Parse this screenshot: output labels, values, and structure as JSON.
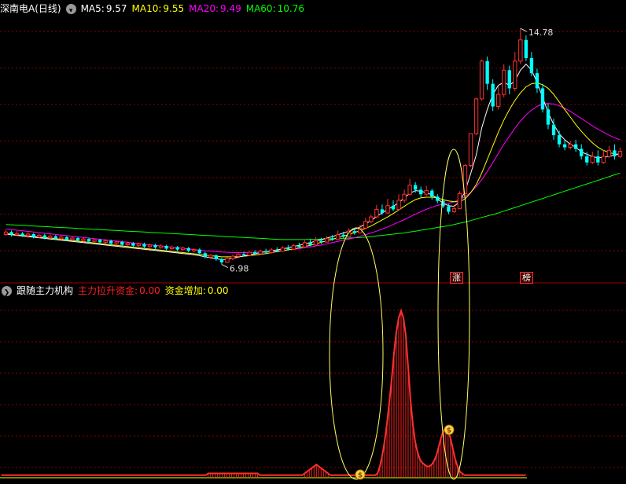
{
  "top_panel": {
    "title": "深南电A(日线)",
    "ma": [
      {
        "label": "MA5:",
        "value": "9.57",
        "color": "#ffffff"
      },
      {
        "label": "MA10:",
        "value": "9.55",
        "color": "#ffff00"
      },
      {
        "label": "MA20:",
        "value": "9.49",
        "color": "#ff00ff"
      },
      {
        "label": "MA60:",
        "value": "10.76",
        "color": "#00ff00"
      }
    ],
    "high_label": "14.78",
    "low_label": "6.98",
    "badges": [
      "涨",
      "榜"
    ]
  },
  "bottom_panel": {
    "title": "跟随主力机构",
    "items": [
      {
        "label": "主力拉升资金:",
        "value": "0.00",
        "color": "#ff2020"
      },
      {
        "label": "资金增加:",
        "value": "0.00",
        "color": "#ffff00"
      }
    ]
  },
  "chart_data": [
    {
      "type": "candlestick",
      "title": "深南电A(日线)",
      "ylim": [
        6.5,
        15.2
      ],
      "colors": {
        "up": "#ff3030",
        "down": "#00ffff",
        "ma5": "#ffffff",
        "ma10": "#ffff00",
        "ma20": "#ff00ff",
        "ma60": "#00ff00",
        "grid": "#8b0000"
      },
      "candles": [
        [
          7.97,
          8.05,
          8.12,
          7.93
        ],
        [
          8.05,
          7.96,
          8.1,
          7.9
        ],
        [
          7.96,
          8.0,
          8.08,
          7.91
        ],
        [
          8.0,
          7.93,
          8.05,
          7.88
        ],
        [
          7.93,
          7.98,
          8.04,
          7.86
        ],
        [
          7.98,
          7.89,
          8.02,
          7.84
        ],
        [
          7.89,
          7.94,
          8.0,
          7.85
        ],
        [
          7.94,
          7.86,
          7.99,
          7.81
        ],
        [
          7.86,
          7.91,
          7.97,
          7.82
        ],
        [
          7.91,
          7.83,
          7.95,
          7.78
        ],
        [
          7.83,
          7.88,
          7.94,
          7.79
        ],
        [
          7.88,
          7.8,
          7.92,
          7.75
        ],
        [
          7.8,
          7.85,
          7.9,
          7.76
        ],
        [
          7.85,
          7.77,
          7.89,
          7.72
        ],
        [
          7.77,
          7.82,
          7.88,
          7.73
        ],
        [
          7.82,
          7.74,
          7.86,
          7.69
        ],
        [
          7.74,
          7.79,
          7.84,
          7.7
        ],
        [
          7.79,
          7.71,
          7.83,
          7.66
        ],
        [
          7.71,
          7.76,
          7.82,
          7.67
        ],
        [
          7.76,
          7.67,
          7.8,
          7.62
        ],
        [
          7.67,
          7.72,
          7.77,
          7.63
        ],
        [
          7.72,
          7.63,
          7.76,
          7.58
        ],
        [
          7.63,
          7.68,
          7.74,
          7.59
        ],
        [
          7.68,
          7.6,
          7.72,
          7.55
        ],
        [
          7.6,
          7.65,
          7.7,
          7.56
        ],
        [
          7.65,
          7.57,
          7.7,
          7.52
        ],
        [
          7.57,
          7.62,
          7.67,
          7.53
        ],
        [
          7.62,
          7.54,
          7.66,
          7.49
        ],
        [
          7.54,
          7.59,
          7.64,
          7.5
        ],
        [
          7.59,
          7.5,
          7.63,
          7.45
        ],
        [
          7.5,
          7.55,
          7.6,
          7.46
        ],
        [
          7.55,
          7.47,
          7.59,
          7.42
        ],
        [
          7.47,
          7.52,
          7.57,
          7.43
        ],
        [
          7.52,
          7.43,
          7.56,
          7.38
        ],
        [
          7.43,
          7.47,
          7.52,
          7.38
        ],
        [
          7.47,
          7.35,
          7.51,
          7.3
        ],
        [
          7.35,
          7.22,
          7.4,
          7.18
        ],
        [
          7.22,
          7.28,
          7.33,
          7.16
        ],
        [
          7.28,
          7.15,
          7.31,
          7.1
        ],
        [
          7.15,
          7.05,
          7.2,
          6.98
        ],
        [
          7.05,
          7.18,
          7.22,
          7.02
        ],
        [
          7.18,
          7.25,
          7.3,
          7.12
        ],
        [
          7.25,
          7.32,
          7.38,
          7.2
        ],
        [
          7.32,
          7.28,
          7.4,
          7.24
        ],
        [
          7.28,
          7.38,
          7.42,
          7.25
        ],
        [
          7.38,
          7.33,
          7.45,
          7.29
        ],
        [
          7.33,
          7.42,
          7.47,
          7.3
        ],
        [
          7.42,
          7.37,
          7.5,
          7.32
        ],
        [
          7.37,
          7.46,
          7.52,
          7.34
        ],
        [
          7.46,
          7.42,
          7.55,
          7.38
        ],
        [
          7.42,
          7.52,
          7.58,
          7.4
        ],
        [
          7.52,
          7.48,
          7.62,
          7.44
        ],
        [
          7.48,
          7.6,
          7.65,
          7.46
        ],
        [
          7.6,
          7.56,
          7.7,
          7.52
        ],
        [
          7.56,
          7.7,
          7.78,
          7.54
        ],
        [
          7.7,
          7.62,
          7.82,
          7.58
        ],
        [
          7.62,
          7.76,
          7.88,
          7.6
        ],
        [
          7.76,
          7.72,
          7.86,
          7.66
        ],
        [
          7.72,
          7.84,
          7.92,
          7.7
        ],
        [
          7.84,
          7.8,
          7.95,
          7.76
        ],
        [
          7.8,
          7.96,
          8.1,
          7.78
        ],
        [
          7.96,
          7.9,
          8.06,
          7.84
        ],
        [
          7.9,
          8.08,
          8.18,
          7.88
        ],
        [
          8.08,
          8.02,
          8.16,
          7.96
        ],
        [
          8.02,
          8.18,
          8.28,
          8.0
        ],
        [
          8.18,
          8.4,
          8.52,
          8.15
        ],
        [
          8.4,
          8.55,
          8.62,
          8.34
        ],
        [
          8.55,
          8.8,
          8.95,
          8.5
        ],
        [
          8.8,
          8.68,
          8.96,
          8.62
        ],
        [
          8.68,
          8.92,
          9.15,
          8.65
        ],
        [
          8.92,
          8.8,
          9.1,
          8.74
        ],
        [
          8.8,
          9.1,
          9.3,
          8.76
        ],
        [
          9.1,
          9.3,
          9.45,
          9.02
        ],
        [
          9.3,
          9.6,
          9.8,
          9.25
        ],
        [
          9.6,
          9.45,
          9.7,
          9.35
        ],
        [
          9.45,
          9.3,
          9.55,
          9.2
        ],
        [
          9.3,
          9.42,
          9.58,
          9.24
        ],
        [
          9.42,
          9.22,
          9.48,
          9.12
        ],
        [
          9.22,
          9.08,
          9.3,
          9.0
        ],
        [
          9.08,
          8.9,
          9.15,
          8.84
        ],
        [
          8.9,
          8.72,
          8.98,
          8.64
        ],
        [
          8.72,
          8.82,
          8.96,
          8.68
        ],
        [
          8.82,
          9.32,
          9.4,
          8.8
        ],
        [
          9.32,
          10.25,
          10.3,
          9.3
        ],
        [
          10.25,
          11.3,
          11.3,
          10.2
        ],
        [
          11.3,
          12.45,
          12.5,
          11.25
        ],
        [
          12.45,
          13.7,
          13.75,
          12.4
        ],
        [
          13.7,
          12.95,
          13.85,
          12.75
        ],
        [
          12.95,
          12.2,
          13.1,
          12.05
        ],
        [
          12.2,
          12.6,
          12.85,
          12.1
        ],
        [
          12.6,
          13.4,
          13.6,
          12.5
        ],
        [
          13.4,
          12.8,
          13.55,
          12.6
        ],
        [
          12.8,
          13.7,
          14.0,
          12.7
        ],
        [
          13.7,
          14.4,
          14.78,
          13.6
        ],
        [
          14.4,
          13.8,
          14.55,
          13.7
        ],
        [
          13.8,
          13.3,
          14.0,
          13.2
        ],
        [
          13.3,
          12.8,
          13.45,
          12.65
        ],
        [
          12.8,
          12.1,
          12.95,
          12.0
        ],
        [
          12.1,
          11.6,
          12.3,
          11.45
        ],
        [
          11.6,
          11.25,
          11.8,
          11.1
        ],
        [
          11.25,
          10.95,
          11.4,
          10.85
        ],
        [
          10.95,
          10.85,
          11.1,
          10.75
        ],
        [
          10.85,
          10.95,
          11.05,
          10.78
        ],
        [
          10.95,
          10.8,
          11.1,
          10.7
        ],
        [
          10.8,
          10.55,
          10.95,
          10.45
        ],
        [
          10.55,
          10.35,
          10.7,
          10.25
        ],
        [
          10.35,
          10.55,
          10.7,
          10.3
        ],
        [
          10.55,
          10.35,
          10.75,
          10.25
        ],
        [
          10.35,
          10.55,
          10.75,
          10.3
        ],
        [
          10.55,
          10.75,
          10.9,
          10.5
        ],
        [
          10.75,
          10.55,
          10.95,
          10.45
        ],
        [
          10.55,
          10.72,
          10.85,
          10.5
        ]
      ],
      "ma5": [
        7.98,
        7.96,
        7.94,
        7.92,
        7.9,
        7.88,
        7.86,
        7.84,
        7.82,
        7.8,
        7.78,
        7.76,
        7.74,
        7.72,
        7.7,
        7.68,
        7.66,
        7.64,
        7.62,
        7.6,
        7.58,
        7.56,
        7.54,
        7.52,
        7.5,
        7.48,
        7.46,
        7.44,
        7.42,
        7.4,
        7.38,
        7.36,
        7.34,
        7.32,
        7.3,
        7.27,
        7.23,
        7.2,
        7.17,
        7.14,
        7.15,
        7.18,
        7.22,
        7.26,
        7.3,
        7.33,
        7.37,
        7.4,
        7.43,
        7.46,
        7.49,
        7.53,
        7.57,
        7.61,
        7.66,
        7.7,
        7.75,
        7.8,
        7.85,
        7.9,
        7.96,
        8.02,
        8.08,
        8.14,
        8.22,
        8.32,
        8.43,
        8.57,
        8.68,
        8.8,
        8.9,
        9.02,
        9.18,
        9.33,
        9.42,
        9.4,
        9.35,
        9.28,
        9.16,
        9.0,
        8.92,
        8.9,
        9.05,
        9.4,
        9.98,
        10.6,
        11.5,
        12.1,
        12.6,
        12.9,
        13.0,
        12.9,
        13.05,
        13.4,
        13.6,
        13.4,
        13.0,
        12.5,
        12.0,
        11.6,
        11.3,
        11.1,
        10.95,
        10.85,
        10.7,
        10.62,
        10.55,
        10.5,
        10.52,
        10.55,
        10.6,
        10.65
      ],
      "ma10": [
        8.0,
        7.98,
        7.96,
        7.94,
        7.92,
        7.91,
        7.89,
        7.87,
        7.85,
        7.83,
        7.81,
        7.79,
        7.77,
        7.75,
        7.73,
        7.71,
        7.69,
        7.67,
        7.65,
        7.63,
        7.61,
        7.59,
        7.57,
        7.55,
        7.53,
        7.51,
        7.49,
        7.47,
        7.45,
        7.43,
        7.41,
        7.39,
        7.37,
        7.35,
        7.33,
        7.31,
        7.29,
        7.27,
        7.25,
        7.23,
        7.23,
        7.23,
        7.24,
        7.25,
        7.27,
        7.29,
        7.31,
        7.34,
        7.37,
        7.4,
        7.43,
        7.46,
        7.49,
        7.53,
        7.57,
        7.61,
        7.66,
        7.71,
        7.76,
        7.81,
        7.86,
        7.91,
        7.97,
        8.03,
        8.1,
        8.17,
        8.25,
        8.35,
        8.45,
        8.55,
        8.66,
        8.78,
        8.9,
        9.02,
        9.12,
        9.18,
        9.2,
        9.2,
        9.18,
        9.12,
        9.08,
        9.05,
        9.05,
        9.15,
        9.35,
        9.62,
        10.0,
        10.45,
        10.9,
        11.35,
        11.75,
        12.1,
        12.4,
        12.65,
        12.85,
        12.95,
        12.98,
        12.92,
        12.8,
        12.6,
        12.35,
        12.1,
        11.85,
        11.6,
        11.38,
        11.18,
        11.0,
        10.85,
        10.75,
        10.68,
        10.63,
        10.6
      ],
      "ma20": [
        8.15,
        8.13,
        8.11,
        8.09,
        8.07,
        8.05,
        8.03,
        8.01,
        7.99,
        7.97,
        7.95,
        7.93,
        7.91,
        7.89,
        7.87,
        7.85,
        7.83,
        7.81,
        7.79,
        7.77,
        7.75,
        7.73,
        7.71,
        7.69,
        7.67,
        7.65,
        7.63,
        7.61,
        7.59,
        7.57,
        7.55,
        7.53,
        7.51,
        7.49,
        7.47,
        7.45,
        7.43,
        7.42,
        7.4,
        7.39,
        7.38,
        7.37,
        7.37,
        7.37,
        7.37,
        7.38,
        7.39,
        7.4,
        7.41,
        7.42,
        7.44,
        7.46,
        7.48,
        7.5,
        7.53,
        7.56,
        7.59,
        7.62,
        7.66,
        7.7,
        7.74,
        7.78,
        7.82,
        7.86,
        7.91,
        7.96,
        8.02,
        8.08,
        8.15,
        8.22,
        8.3,
        8.38,
        8.46,
        8.55,
        8.64,
        8.72,
        8.8,
        8.87,
        8.93,
        8.97,
        9.0,
        9.05,
        9.12,
        9.22,
        9.36,
        9.55,
        9.78,
        10.05,
        10.35,
        10.65,
        10.95,
        11.22,
        11.48,
        11.72,
        11.92,
        12.08,
        12.2,
        12.28,
        12.3,
        12.28,
        12.22,
        12.14,
        12.04,
        11.92,
        11.8,
        11.68,
        11.56,
        11.45,
        11.35,
        11.25,
        11.17,
        11.1
      ],
      "ma60": [
        8.3,
        8.29,
        8.28,
        8.27,
        8.26,
        8.25,
        8.24,
        8.23,
        8.22,
        8.21,
        8.2,
        8.19,
        8.18,
        8.17,
        8.16,
        8.15,
        8.14,
        8.13,
        8.12,
        8.11,
        8.1,
        8.09,
        8.08,
        8.07,
        8.06,
        8.05,
        8.04,
        8.03,
        8.02,
        8.01,
        8.0,
        7.99,
        7.98,
        7.97,
        7.96,
        7.95,
        7.94,
        7.93,
        7.92,
        7.91,
        7.9,
        7.89,
        7.88,
        7.87,
        7.86,
        7.85,
        7.84,
        7.83,
        7.82,
        7.81,
        7.8,
        7.8,
        7.8,
        7.8,
        7.8,
        7.81,
        7.81,
        7.82,
        7.82,
        7.83,
        7.83,
        7.84,
        7.85,
        7.86,
        7.87,
        7.88,
        7.9,
        7.92,
        7.94,
        7.96,
        7.98,
        8.0,
        8.02,
        8.05,
        8.08,
        8.11,
        8.14,
        8.17,
        8.2,
        8.23,
        8.26,
        8.3,
        8.34,
        8.38,
        8.43,
        8.48,
        8.53,
        8.58,
        8.63,
        8.68,
        8.74,
        8.8,
        8.86,
        8.92,
        8.98,
        9.04,
        9.1,
        9.16,
        9.22,
        9.28,
        9.34,
        9.4,
        9.46,
        9.52,
        9.58,
        9.64,
        9.7,
        9.76,
        9.82,
        9.88,
        9.94,
        10.0
      ]
    },
    {
      "type": "bar",
      "title": "跟随主力机构",
      "ylim": [
        0,
        100
      ],
      "values": [
        1,
        1,
        1,
        1,
        1,
        1,
        1,
        1,
        1,
        1,
        1,
        1,
        1,
        1,
        1,
        1,
        1,
        1,
        1,
        1,
        1,
        1,
        1,
        1,
        1,
        1,
        1,
        1,
        1,
        1,
        1,
        1,
        1,
        1,
        1,
        1,
        1,
        1,
        1,
        1,
        1,
        1,
        1,
        1,
        1,
        1,
        1,
        1,
        1,
        1,
        1,
        1,
        1,
        1,
        1,
        1,
        1,
        1,
        1,
        1,
        1,
        1,
        1,
        1,
        1,
        1,
        1,
        1,
        1,
        1,
        1,
        1,
        1,
        1,
        1,
        1,
        1,
        1,
        1,
        1,
        1,
        1,
        1,
        1,
        1,
        1,
        1,
        1,
        2,
        2,
        2,
        2,
        2,
        2,
        2,
        2,
        2,
        2,
        2,
        2,
        2,
        2,
        2,
        2,
        2,
        2,
        2,
        2,
        2,
        2,
        1,
        1,
        1,
        1,
        1,
        1,
        1,
        1,
        1,
        1,
        1,
        1,
        1,
        1,
        1,
        1,
        1,
        1,
        1,
        2,
        3,
        4,
        5,
        6,
        7,
        6,
        5,
        4,
        3,
        2,
        1,
        1,
        1,
        1,
        1,
        1,
        1,
        1,
        1,
        1,
        1,
        1,
        1,
        1,
        1,
        1,
        1,
        1,
        1,
        1,
        2,
        6,
        12,
        20,
        30,
        42,
        55,
        70,
        82,
        90,
        94,
        90,
        80,
        62,
        44,
        30,
        20,
        14,
        10,
        8,
        7,
        6,
        6,
        7,
        9,
        12,
        17,
        22,
        26,
        28,
        26,
        22,
        16,
        10,
        6,
        3,
        2,
        1,
        1,
        1,
        1,
        1,
        1,
        1,
        1,
        1,
        1,
        1,
        1,
        1,
        1,
        1,
        1,
        1,
        1,
        1,
        1,
        1,
        1,
        1,
        1,
        1,
        1,
        1
      ],
      "colors": {
        "bar": "#ff2020",
        "line": "#ff3030",
        "baseline": "#ffff00"
      }
    }
  ]
}
